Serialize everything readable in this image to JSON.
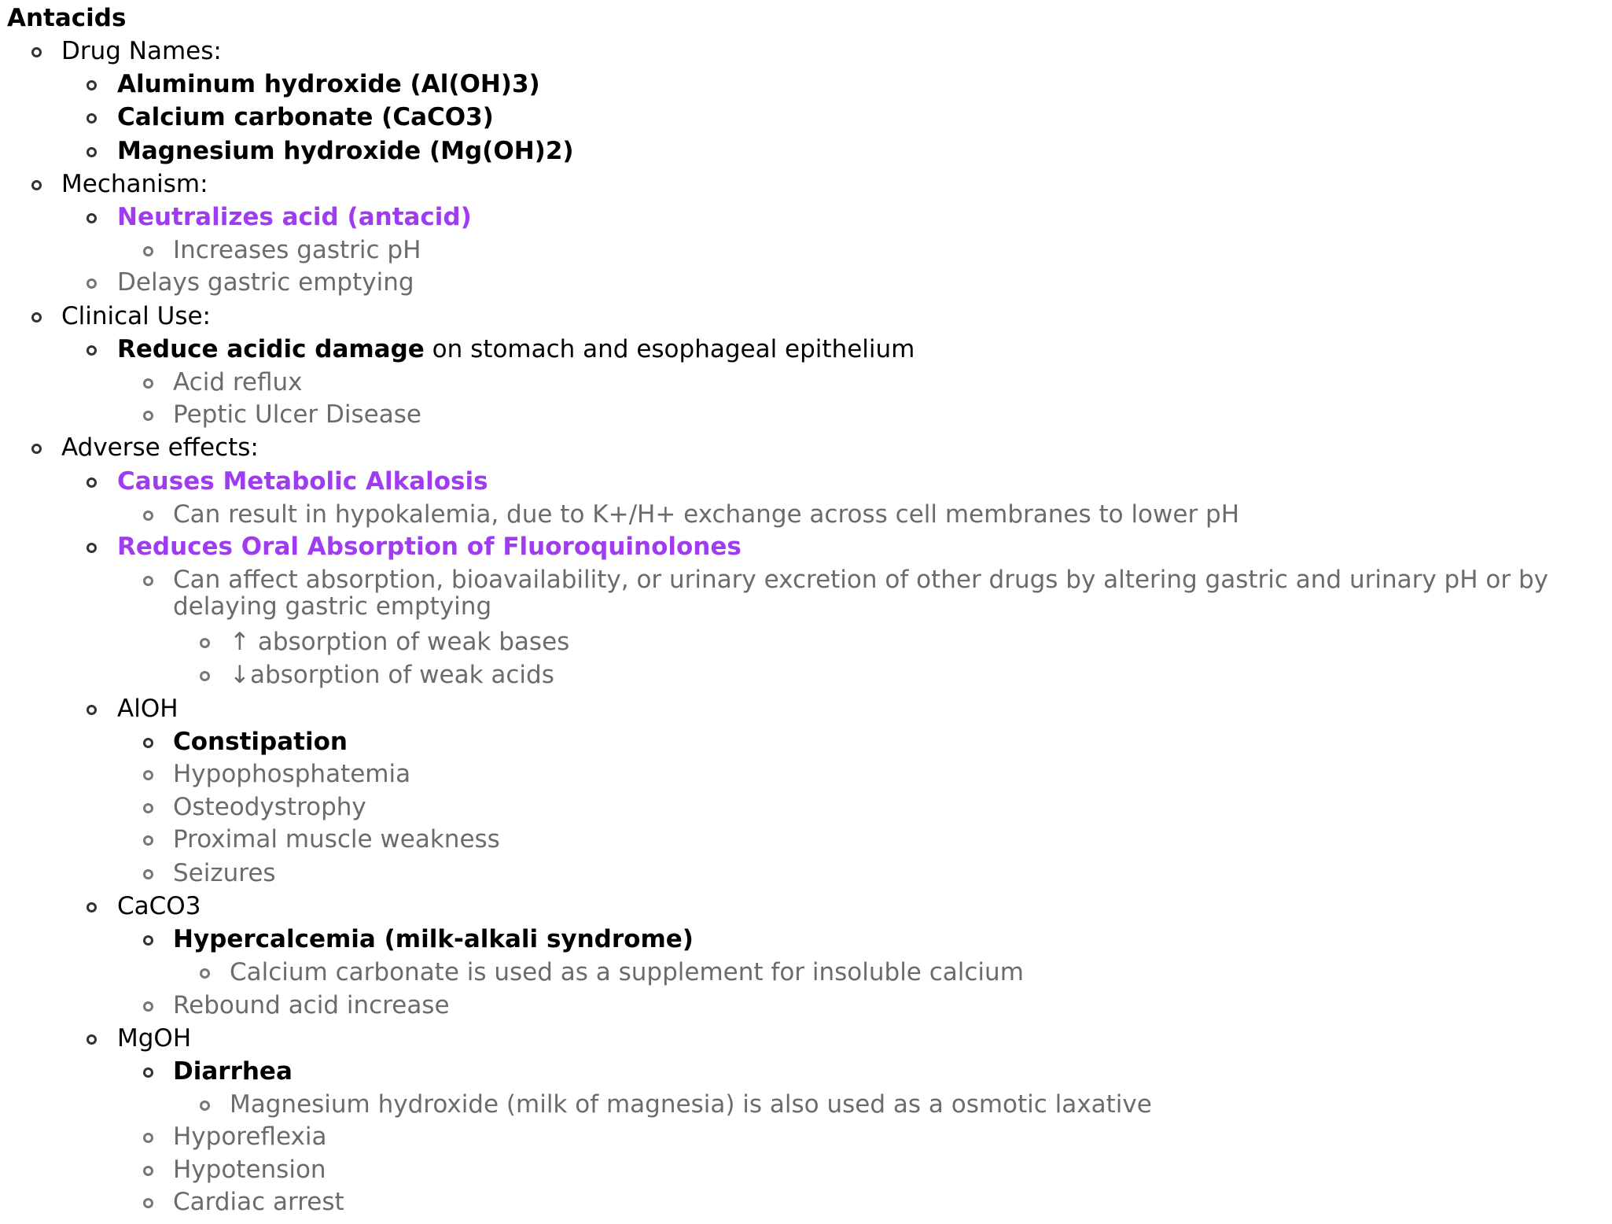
{
  "title": "Antacids",
  "sections": {
    "drug_names": {
      "label": "Drug Names:",
      "items": [
        "Aluminum hydroxide (Al(OH)3)",
        "Calcium carbonate (CaCO3)",
        "Magnesium hydroxide (Mg(OH)2)"
      ]
    },
    "mechanism": {
      "label": "Mechanism:",
      "neutralizes": "Neutralizes acid (antacid)",
      "increases_ph": "Increases gastric pH",
      "delays": "Delays gastric emptying"
    },
    "clinical_use": {
      "label": "Clinical Use:",
      "reduce_bold": "Reduce acidic damage",
      "reduce_rest": " on stomach and esophageal epithelium",
      "acid_reflux": "Acid reflux",
      "pud": "Peptic Ulcer Disease"
    },
    "adverse": {
      "label": "Adverse effects:",
      "alkalosis": "Causes Metabolic Alkalosis",
      "hypokalemia": "Can result in hypokalemia, due to K+/H+ exchange across cell membranes to lower pH",
      "fluoroquinolones": "Reduces Oral Absorption of Fluoroquinolones",
      "affect_absorption": "Can affect absorption, bioavailability, or urinary excretion of other drugs by altering gastric and urinary pH or by delaying gastric emptying",
      "weak_bases": "↑ absorption of weak bases",
      "weak_acids": "↓absorption of weak acids",
      "aloh": {
        "label": "AlOH",
        "constipation": "Constipation",
        "hypophosphatemia": "Hypophosphatemia",
        "osteodystrophy": "Osteodystrophy",
        "muscle": "Proximal muscle weakness",
        "seizures": "Seizures"
      },
      "caco3": {
        "label": "CaCO3",
        "hypercalcemia": "Hypercalcemia (milk-alkali syndrome)",
        "supplement": "Calcium carbonate is used as a supplement for insoluble calcium",
        "rebound": "Rebound acid increase"
      },
      "mgoh": {
        "label": "MgOH",
        "diarrhea": "Diarrhea",
        "laxative": "Magnesium hydroxide (milk of magnesia) is also used as a osmotic laxative",
        "hyporeflexia": "Hyporeflexia",
        "hypotension": "Hypotension",
        "cardiac": "Cardiac arrest"
      }
    }
  },
  "colors": {
    "accent": "#a03cf0",
    "secondary_text": "#6b6b6b",
    "primary_text": "#000000"
  }
}
